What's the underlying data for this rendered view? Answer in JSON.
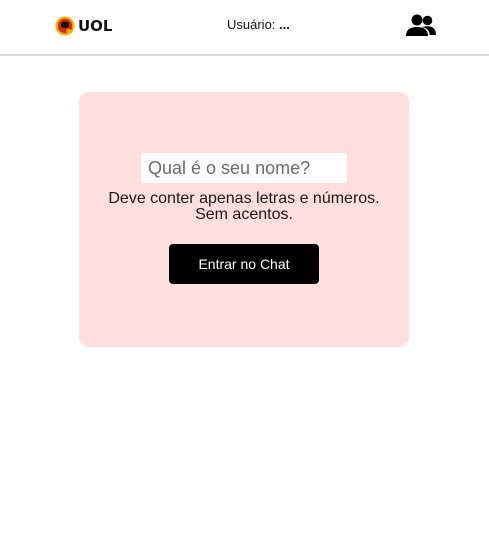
{
  "header": {
    "logo_text": "UOL",
    "user_label": "Usuário:",
    "user_value": "...",
    "people_icon": "people-icon"
  },
  "login_card": {
    "name_placeholder": "Qual é o seu nome?",
    "name_value": "",
    "hint_line1": "Deve conter apenas letras e números.",
    "hint_line2": "Sem acentos.",
    "enter_label": "Entrar no Chat"
  },
  "colors": {
    "card_background": "#ffdfdd",
    "button_background": "#000000",
    "logo_red": "#d8261c",
    "logo_yellow": "#f4b400"
  }
}
